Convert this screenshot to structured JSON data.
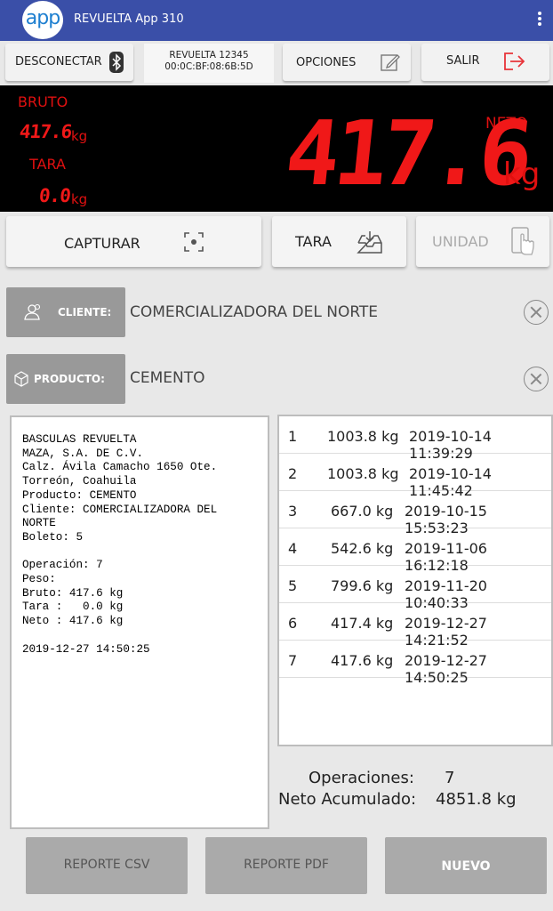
{
  "app": {
    "logo_text": "app",
    "title": "REVUELTA App 310",
    "menu_icon": "more-vert-icon"
  },
  "toolbar": {
    "disconnect_label": "DESCONECTAR",
    "device_name": "REVUELTA 12345",
    "device_mac": "00:0C:BF:08:6B:5D",
    "options_label": "OPCIONES",
    "exit_label": "SALIR"
  },
  "display": {
    "bruto_label": "BRUTO",
    "bruto_value": "417.6",
    "bruto_unit": "kg",
    "tara_label": "TARA",
    "tara_value": "0.0",
    "tara_unit": "kg",
    "neto_label": "NETO",
    "neto_value": "417.6",
    "neto_unit": "kg"
  },
  "actions": {
    "capture_label": "CAPTURAR",
    "tare_label": "TARA",
    "unit_label": "UNIDAD"
  },
  "client": {
    "label": "CLIENTE:",
    "value": "COMERCIALIZADORA DEL NORTE"
  },
  "product": {
    "label": "PRODUCTO:",
    "value": "CEMENTO"
  },
  "ticket": {
    "lines": [
      "BASCULAS REVUELTA",
      "MAZA, S.A. DE C.V.",
      "Calz. Ávila Camacho 1650 Ote.",
      "Torreón, Coahuila",
      "Producto: CEMENTO",
      "Cliente: COMERCIALIZADORA DEL",
      "NORTE",
      "Boleto: 5",
      "",
      "Operación: 7",
      "Peso:",
      "Bruto: 417.6 kg",
      "Tara :   0.0 kg",
      "Neto : 417.6 kg",
      "",
      "2019-12-27 14:50:25"
    ]
  },
  "operations": [
    {
      "num": "1",
      "weight": "1003.8 kg",
      "datetime": "2019-10-14 11:39:29"
    },
    {
      "num": "2",
      "weight": "1003.8 kg",
      "datetime": "2019-10-14 11:45:42"
    },
    {
      "num": "3",
      "weight": "667.0 kg",
      "datetime": "2019-10-15 15:53:23"
    },
    {
      "num": "4",
      "weight": "542.6 kg",
      "datetime": "2019-11-06 16:12:18"
    },
    {
      "num": "5",
      "weight": "799.6 kg",
      "datetime": "2019-11-20 10:40:33"
    },
    {
      "num": "6",
      "weight": "417.4 kg",
      "datetime": "2019-12-27 14:21:52"
    },
    {
      "num": "7",
      "weight": "417.6 kg",
      "datetime": "2019-12-27 14:50:25"
    }
  ],
  "summary": {
    "operations_label": "Operaciones:",
    "operations_value": "7",
    "net_label": "Neto Acumulado:",
    "net_value": "4851.8 kg"
  },
  "bottom": {
    "csv_label": "REPORTE CSV",
    "pdf_label": "REPORTE PDF",
    "new_label": "NUEVO"
  },
  "colors": {
    "appbar": "#3a4fa8",
    "display_red": "#f01818",
    "disabled": "#aaaaaa"
  }
}
